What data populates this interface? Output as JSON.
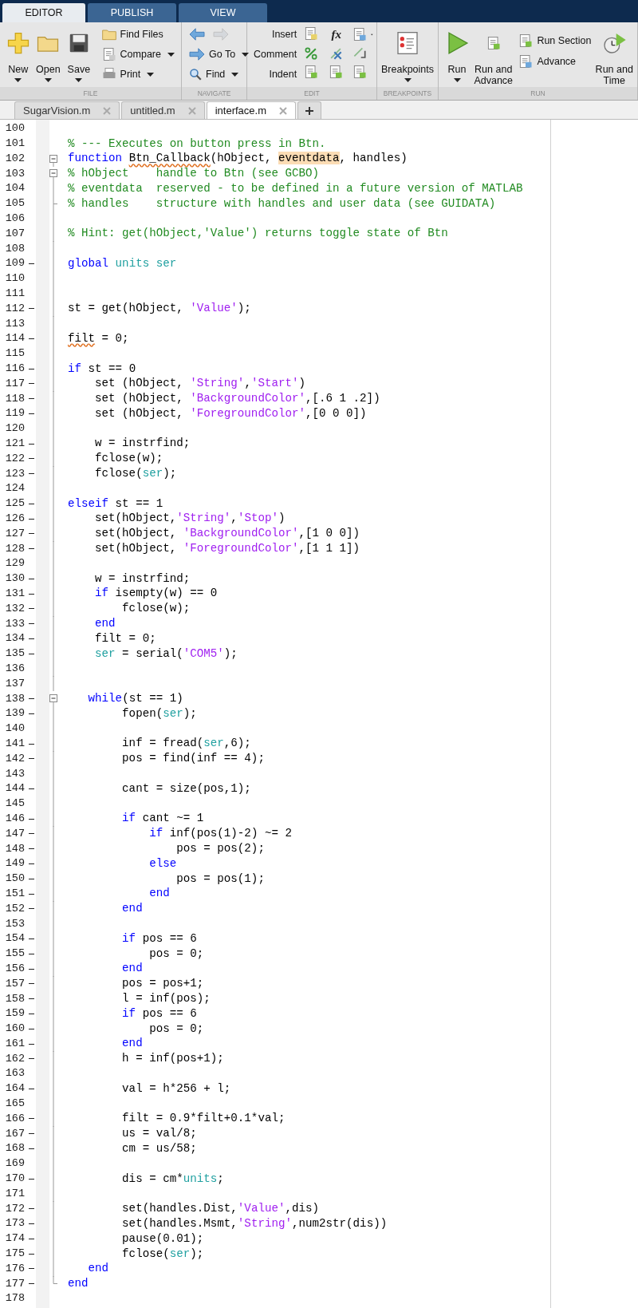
{
  "ribbon_tabs": [
    {
      "label": "EDITOR",
      "selected": true
    },
    {
      "label": "PUBLISH",
      "selected": false
    },
    {
      "label": "VIEW",
      "selected": false
    }
  ],
  "file_section": {
    "new": "New",
    "open": "Open",
    "save": "Save",
    "find_files": "Find Files",
    "compare": "Compare",
    "print": "Print",
    "title": "FILE"
  },
  "navigate_section": {
    "go_to": "Go To",
    "find": "Find",
    "title": "NAVIGATE"
  },
  "edit_section": {
    "insert": "Insert",
    "comment": "Comment",
    "indent": "Indent",
    "function_symbol": "fx",
    "title": "EDIT"
  },
  "breakpoints_section": {
    "breakpoints": "Breakpoints",
    "title": "BREAKPOINTS"
  },
  "run_section": {
    "run": "Run",
    "run_and_advance": "Run and Advance",
    "run_section": "Run Section",
    "advance": "Advance",
    "run_and_time": "Run and Time",
    "title": "RUN"
  },
  "file_tabs": [
    {
      "label": "SugarVision.m",
      "selected": false
    },
    {
      "label": "untitled.m",
      "selected": false
    },
    {
      "label": "interface.m",
      "selected": true
    }
  ],
  "lines": [
    {
      "number": "100",
      "executable": false,
      "kind": "plain"
    },
    {
      "number": "101",
      "executable": false,
      "kind": "plain",
      "tokens": [
        {
          "kind": "comment",
          "text": "% --- Executes on button press in Btn."
        }
      ]
    },
    {
      "number": "102",
      "executable": false,
      "kind": "fold-open",
      "tokens": [
        {
          "kind": "keyword",
          "text": "function "
        },
        {
          "kind": "warning",
          "text": "Btn_Callback"
        },
        {
          "kind": "plain",
          "text": "(hObject, "
        },
        {
          "kind": "highlight",
          "text": "eventdata"
        },
        {
          "kind": "plain",
          "text": ", handles)"
        }
      ]
    },
    {
      "number": "103",
      "executable": false,
      "kind": "fold-open",
      "tokens": [
        {
          "kind": "comment",
          "text": "% hObject    handle to Btn (see GCBO)"
        }
      ]
    },
    {
      "number": "104",
      "executable": false,
      "kind": "fold-line",
      "tokens": [
        {
          "kind": "comment",
          "text": "% eventdata  reserved - to be defined in a future version of MATLAB"
        }
      ]
    },
    {
      "number": "105",
      "executable": false,
      "kind": "fold-branch",
      "tokens": [
        {
          "kind": "comment",
          "text": "% handles    structure with handles and user data (see GUIDATA)"
        }
      ]
    },
    {
      "number": "106",
      "executable": false,
      "kind": "fold-line"
    },
    {
      "number": "107",
      "executable": false,
      "kind": "fold-line",
      "tokens": [
        {
          "kind": "comment",
          "text": "% Hint: get(hObject,'Value') returns toggle state of Btn"
        }
      ]
    },
    {
      "number": "108",
      "executable": false,
      "kind": "fold-line"
    },
    {
      "number": "109",
      "executable": true,
      "kind": "fold-line",
      "tokens": [
        {
          "kind": "keyword",
          "text": "global "
        },
        {
          "kind": "global",
          "text": "units ser"
        }
      ]
    },
    {
      "number": "110",
      "executable": false,
      "kind": "fold-line"
    },
    {
      "number": "111",
      "executable": false,
      "kind": "fold-line"
    },
    {
      "number": "112",
      "executable": true,
      "kind": "fold-line",
      "tokens": [
        {
          "kind": "plain",
          "text": "st = get(hObject, "
        },
        {
          "kind": "string",
          "text": "'Value'"
        },
        {
          "kind": "plain",
          "text": ");"
        }
      ]
    },
    {
      "number": "113",
      "executable": false,
      "kind": "fold-line"
    },
    {
      "number": "114",
      "executable": true,
      "kind": "fold-line",
      "tokens": [
        {
          "kind": "warning",
          "text": "filt"
        },
        {
          "kind": "plain",
          "text": " = 0;"
        }
      ]
    },
    {
      "number": "115",
      "executable": false,
      "kind": "fold-line"
    },
    {
      "number": "116",
      "executable": true,
      "kind": "fold-line",
      "tokens": [
        {
          "kind": "keyword",
          "text": "if"
        },
        {
          "kind": "plain",
          "text": " st == 0"
        }
      ]
    },
    {
      "number": "117",
      "executable": true,
      "kind": "fold-line",
      "tokens": [
        {
          "kind": "plain",
          "text": "    set (hObject, "
        },
        {
          "kind": "string",
          "text": "'String'"
        },
        {
          "kind": "plain",
          "text": ","
        },
        {
          "kind": "string",
          "text": "'Start'"
        },
        {
          "kind": "plain",
          "text": ")"
        }
      ]
    },
    {
      "number": "118",
      "executable": true,
      "kind": "fold-line",
      "tokens": [
        {
          "kind": "plain",
          "text": "    set (hObject, "
        },
        {
          "kind": "string",
          "text": "'BackgroundColor'"
        },
        {
          "kind": "plain",
          "text": ",[.6 1 .2])"
        }
      ]
    },
    {
      "number": "119",
      "executable": true,
      "kind": "fold-line",
      "tokens": [
        {
          "kind": "plain",
          "text": "    set (hObject, "
        },
        {
          "kind": "string",
          "text": "'ForegroundColor'"
        },
        {
          "kind": "plain",
          "text": ",[0 0 0])"
        }
      ]
    },
    {
      "number": "120",
      "executable": false,
      "kind": "fold-line"
    },
    {
      "number": "121",
      "executable": true,
      "kind": "fold-line",
      "tokens": [
        {
          "kind": "plain",
          "text": "    w = instrfind;"
        }
      ]
    },
    {
      "number": "122",
      "executable": true,
      "kind": "fold-line",
      "tokens": [
        {
          "kind": "plain",
          "text": "    fclose(w);"
        }
      ]
    },
    {
      "number": "123",
      "executable": true,
      "kind": "fold-line",
      "tokens": [
        {
          "kind": "plain",
          "text": "    fclose("
        },
        {
          "kind": "global",
          "text": "ser"
        },
        {
          "kind": "plain",
          "text": ");"
        }
      ]
    },
    {
      "number": "124",
      "executable": false,
      "kind": "fold-line"
    },
    {
      "number": "125",
      "executable": true,
      "kind": "fold-line",
      "tokens": [
        {
          "kind": "keyword",
          "text": "elseif"
        },
        {
          "kind": "plain",
          "text": " st == 1"
        }
      ]
    },
    {
      "number": "126",
      "executable": true,
      "kind": "fold-line",
      "tokens": [
        {
          "kind": "plain",
          "text": "    set(hObject,"
        },
        {
          "kind": "string",
          "text": "'String'"
        },
        {
          "kind": "plain",
          "text": ","
        },
        {
          "kind": "string",
          "text": "'Stop'"
        },
        {
          "kind": "plain",
          "text": ")"
        }
      ]
    },
    {
      "number": "127",
      "executable": true,
      "kind": "fold-line",
      "tokens": [
        {
          "kind": "plain",
          "text": "    set(hObject, "
        },
        {
          "kind": "string",
          "text": "'BackgroundColor'"
        },
        {
          "kind": "plain",
          "text": ",[1 0 0])"
        }
      ]
    },
    {
      "number": "128",
      "executable": true,
      "kind": "fold-line",
      "tokens": [
        {
          "kind": "plain",
          "text": "    set(hObject, "
        },
        {
          "kind": "string",
          "text": "'ForegroundColor'"
        },
        {
          "kind": "plain",
          "text": ",[1 1 1])"
        }
      ]
    },
    {
      "number": "129",
      "executable": false,
      "kind": "fold-line"
    },
    {
      "number": "130",
      "executable": true,
      "kind": "fold-line",
      "tokens": [
        {
          "kind": "plain",
          "text": "    w = instrfind;"
        }
      ]
    },
    {
      "number": "131",
      "executable": true,
      "kind": "fold-line",
      "tokens": [
        {
          "kind": "keyword",
          "text": "    if"
        },
        {
          "kind": "plain",
          "text": " isempty(w) == 0"
        }
      ]
    },
    {
      "number": "132",
      "executable": true,
      "kind": "fold-line",
      "tokens": [
        {
          "kind": "plain",
          "text": "        fclose(w);"
        }
      ]
    },
    {
      "number": "133",
      "executable": true,
      "kind": "fold-line",
      "tokens": [
        {
          "kind": "keyword",
          "text": "    end"
        }
      ]
    },
    {
      "number": "134",
      "executable": true,
      "kind": "fold-line",
      "tokens": [
        {
          "kind": "plain",
          "text": "    filt = 0;"
        }
      ]
    },
    {
      "number": "135",
      "executable": true,
      "kind": "fold-line",
      "tokens": [
        {
          "kind": "global",
          "text": "    ser"
        },
        {
          "kind": "plain",
          "text": " = serial("
        },
        {
          "kind": "string",
          "text": "'COM5'"
        },
        {
          "kind": "plain",
          "text": ");"
        }
      ]
    },
    {
      "number": "136",
      "executable": false,
      "kind": "fold-line"
    },
    {
      "number": "137",
      "executable": false,
      "kind": "fold-line"
    },
    {
      "number": "138",
      "executable": true,
      "kind": "fold-open",
      "tokens": [
        {
          "kind": "keyword",
          "text": "   while"
        },
        {
          "kind": "plain",
          "text": "(st == 1)"
        }
      ]
    },
    {
      "number": "139",
      "executable": true,
      "kind": "fold-line",
      "tokens": [
        {
          "kind": "plain",
          "text": "        fopen("
        },
        {
          "kind": "global",
          "text": "ser"
        },
        {
          "kind": "plain",
          "text": ");"
        }
      ]
    },
    {
      "number": "140",
      "executable": false,
      "kind": "fold-line"
    },
    {
      "number": "141",
      "executable": true,
      "kind": "fold-line",
      "tokens": [
        {
          "kind": "plain",
          "text": "        inf = fread("
        },
        {
          "kind": "global",
          "text": "ser"
        },
        {
          "kind": "plain",
          "text": ",6);"
        }
      ]
    },
    {
      "number": "142",
      "executable": true,
      "kind": "fold-line",
      "tokens": [
        {
          "kind": "plain",
          "text": "        pos = find(inf == 4);"
        }
      ]
    },
    {
      "number": "143",
      "executable": false,
      "kind": "fold-line"
    },
    {
      "number": "144",
      "executable": true,
      "kind": "fold-line",
      "tokens": [
        {
          "kind": "plain",
          "text": "        cant = size(pos,1);"
        }
      ]
    },
    {
      "number": "145",
      "executable": false,
      "kind": "fold-line"
    },
    {
      "number": "146",
      "executable": true,
      "kind": "fold-line",
      "tokens": [
        {
          "kind": "keyword",
          "text": "        if"
        },
        {
          "kind": "plain",
          "text": " cant ~= 1"
        }
      ]
    },
    {
      "number": "147",
      "executable": true,
      "kind": "fold-line",
      "tokens": [
        {
          "kind": "keyword",
          "text": "            if"
        },
        {
          "kind": "plain",
          "text": " inf(pos(1)-2) ~= 2"
        }
      ]
    },
    {
      "number": "148",
      "executable": true,
      "kind": "fold-line",
      "tokens": [
        {
          "kind": "plain",
          "text": "                pos = pos(2);"
        }
      ]
    },
    {
      "number": "149",
      "executable": true,
      "kind": "fold-line",
      "tokens": [
        {
          "kind": "keyword",
          "text": "            else"
        }
      ]
    },
    {
      "number": "150",
      "executable": true,
      "kind": "fold-line",
      "tokens": [
        {
          "kind": "plain",
          "text": "                pos = pos(1);"
        }
      ]
    },
    {
      "number": "151",
      "executable": true,
      "kind": "fold-line",
      "tokens": [
        {
          "kind": "keyword",
          "text": "            end"
        }
      ]
    },
    {
      "number": "152",
      "executable": true,
      "kind": "fold-line",
      "tokens": [
        {
          "kind": "keyword",
          "text": "        end"
        }
      ]
    },
    {
      "number": "153",
      "executable": false,
      "kind": "fold-line"
    },
    {
      "number": "154",
      "executable": true,
      "kind": "fold-line",
      "tokens": [
        {
          "kind": "keyword",
          "text": "        if"
        },
        {
          "kind": "plain",
          "text": " pos == 6"
        }
      ]
    },
    {
      "number": "155",
      "executable": true,
      "kind": "fold-line",
      "tokens": [
        {
          "kind": "plain",
          "text": "            pos = 0;"
        }
      ]
    },
    {
      "number": "156",
      "executable": true,
      "kind": "fold-line",
      "tokens": [
        {
          "kind": "keyword",
          "text": "        end"
        }
      ]
    },
    {
      "number": "157",
      "executable": true,
      "kind": "fold-line",
      "tokens": [
        {
          "kind": "plain",
          "text": "        pos = pos+1;"
        }
      ]
    },
    {
      "number": "158",
      "executable": true,
      "kind": "fold-line",
      "tokens": [
        {
          "kind": "plain",
          "text": "        l = inf(pos);"
        }
      ]
    },
    {
      "number": "159",
      "executable": true,
      "kind": "fold-line",
      "tokens": [
        {
          "kind": "keyword",
          "text": "        if"
        },
        {
          "kind": "plain",
          "text": " pos == 6"
        }
      ]
    },
    {
      "number": "160",
      "executable": true,
      "kind": "fold-line",
      "tokens": [
        {
          "kind": "plain",
          "text": "            pos = 0;"
        }
      ]
    },
    {
      "number": "161",
      "executable": true,
      "kind": "fold-line",
      "tokens": [
        {
          "kind": "keyword",
          "text": "        end"
        }
      ]
    },
    {
      "number": "162",
      "executable": true,
      "kind": "fold-line",
      "tokens": [
        {
          "kind": "plain",
          "text": "        h = inf(pos+1);"
        }
      ]
    },
    {
      "number": "163",
      "executable": false,
      "kind": "fold-line"
    },
    {
      "number": "164",
      "executable": true,
      "kind": "fold-line",
      "tokens": [
        {
          "kind": "plain",
          "text": "        val = h*256 + l;"
        }
      ]
    },
    {
      "number": "165",
      "executable": false,
      "kind": "fold-line"
    },
    {
      "number": "166",
      "executable": true,
      "kind": "fold-line",
      "tokens": [
        {
          "kind": "plain",
          "text": "        filt = 0.9*filt+0.1*val;"
        }
      ]
    },
    {
      "number": "167",
      "executable": true,
      "kind": "fold-line",
      "tokens": [
        {
          "kind": "plain",
          "text": "        us = val/8;"
        }
      ]
    },
    {
      "number": "168",
      "executable": true,
      "kind": "fold-line",
      "tokens": [
        {
          "kind": "plain",
          "text": "        cm = us/58;"
        }
      ]
    },
    {
      "number": "169",
      "executable": false,
      "kind": "fold-line"
    },
    {
      "number": "170",
      "executable": true,
      "kind": "fold-line",
      "tokens": [
        {
          "kind": "plain",
          "text": "        dis = cm*"
        },
        {
          "kind": "global",
          "text": "units"
        },
        {
          "kind": "plain",
          "text": ";"
        }
      ]
    },
    {
      "number": "171",
      "executable": false,
      "kind": "fold-line"
    },
    {
      "number": "172",
      "executable": true,
      "kind": "fold-line",
      "tokens": [
        {
          "kind": "plain",
          "text": "        set(handles.Dist,"
        },
        {
          "kind": "string",
          "text": "'Value'"
        },
        {
          "kind": "plain",
          "text": ",dis)"
        }
      ]
    },
    {
      "number": "173",
      "executable": true,
      "kind": "fold-line",
      "tokens": [
        {
          "kind": "plain",
          "text": "        set(handles.Msmt,"
        },
        {
          "kind": "string",
          "text": "'String'"
        },
        {
          "kind": "plain",
          "text": ",num2str(dis))"
        }
      ]
    },
    {
      "number": "174",
      "executable": true,
      "kind": "fold-line",
      "tokens": [
        {
          "kind": "plain",
          "text": "        pause(0.01);"
        }
      ]
    },
    {
      "number": "175",
      "executable": true,
      "kind": "fold-line",
      "tokens": [
        {
          "kind": "plain",
          "text": "        fclose("
        },
        {
          "kind": "global",
          "text": "ser"
        },
        {
          "kind": "plain",
          "text": ");"
        }
      ]
    },
    {
      "number": "176",
      "executable": true,
      "kind": "fold-line",
      "tokens": [
        {
          "kind": "keyword",
          "text": "   end"
        }
      ]
    },
    {
      "number": "177",
      "executable": true,
      "kind": "fold-close",
      "tokens": [
        {
          "kind": "keyword",
          "text": "end"
        }
      ]
    },
    {
      "number": "178",
      "executable": false,
      "kind": "plain"
    }
  ]
}
